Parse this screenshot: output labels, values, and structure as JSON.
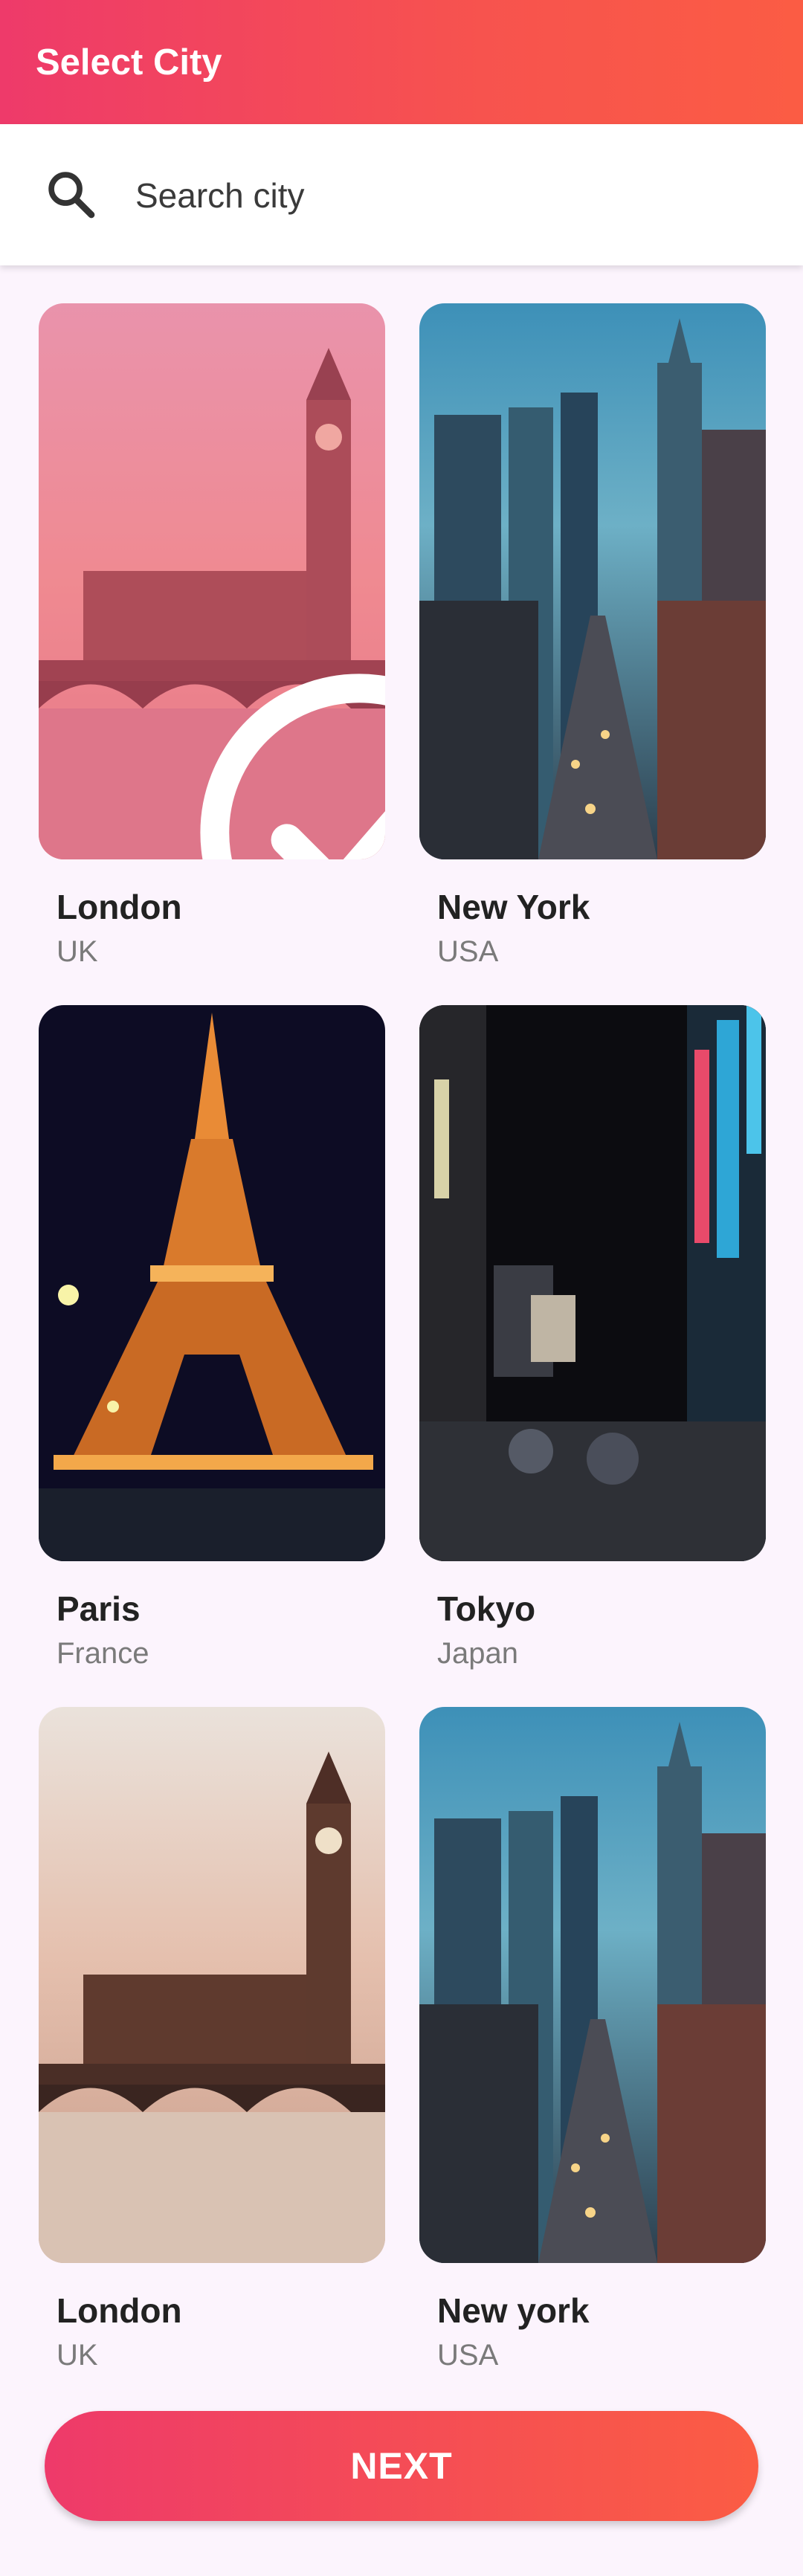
{
  "app_bar": {
    "title": "Select City"
  },
  "search": {
    "placeholder": "Search city",
    "icon": "search-icon"
  },
  "cities": [
    {
      "name": "London",
      "country": "UK",
      "selected": true,
      "image": "big-ben-photo"
    },
    {
      "name": "New York",
      "country": "USA",
      "selected": false,
      "image": "new-york-street-photo"
    },
    {
      "name": "Paris",
      "country": "France",
      "selected": false,
      "image": "eiffel-tower-photo"
    },
    {
      "name": "Tokyo",
      "country": "Japan",
      "selected": false,
      "image": "tokyo-night-street-photo"
    },
    {
      "name": "London",
      "country": "UK",
      "selected": false,
      "image": "big-ben-photo"
    },
    {
      "name": "New york",
      "country": "USA",
      "selected": false,
      "image": "new-york-street-photo"
    }
  ],
  "footer": {
    "next_label": "NEXT"
  },
  "colors": {
    "accent_start": "#ee3a6a",
    "accent_end": "#fb5c44",
    "background": "#fcf4fd"
  }
}
